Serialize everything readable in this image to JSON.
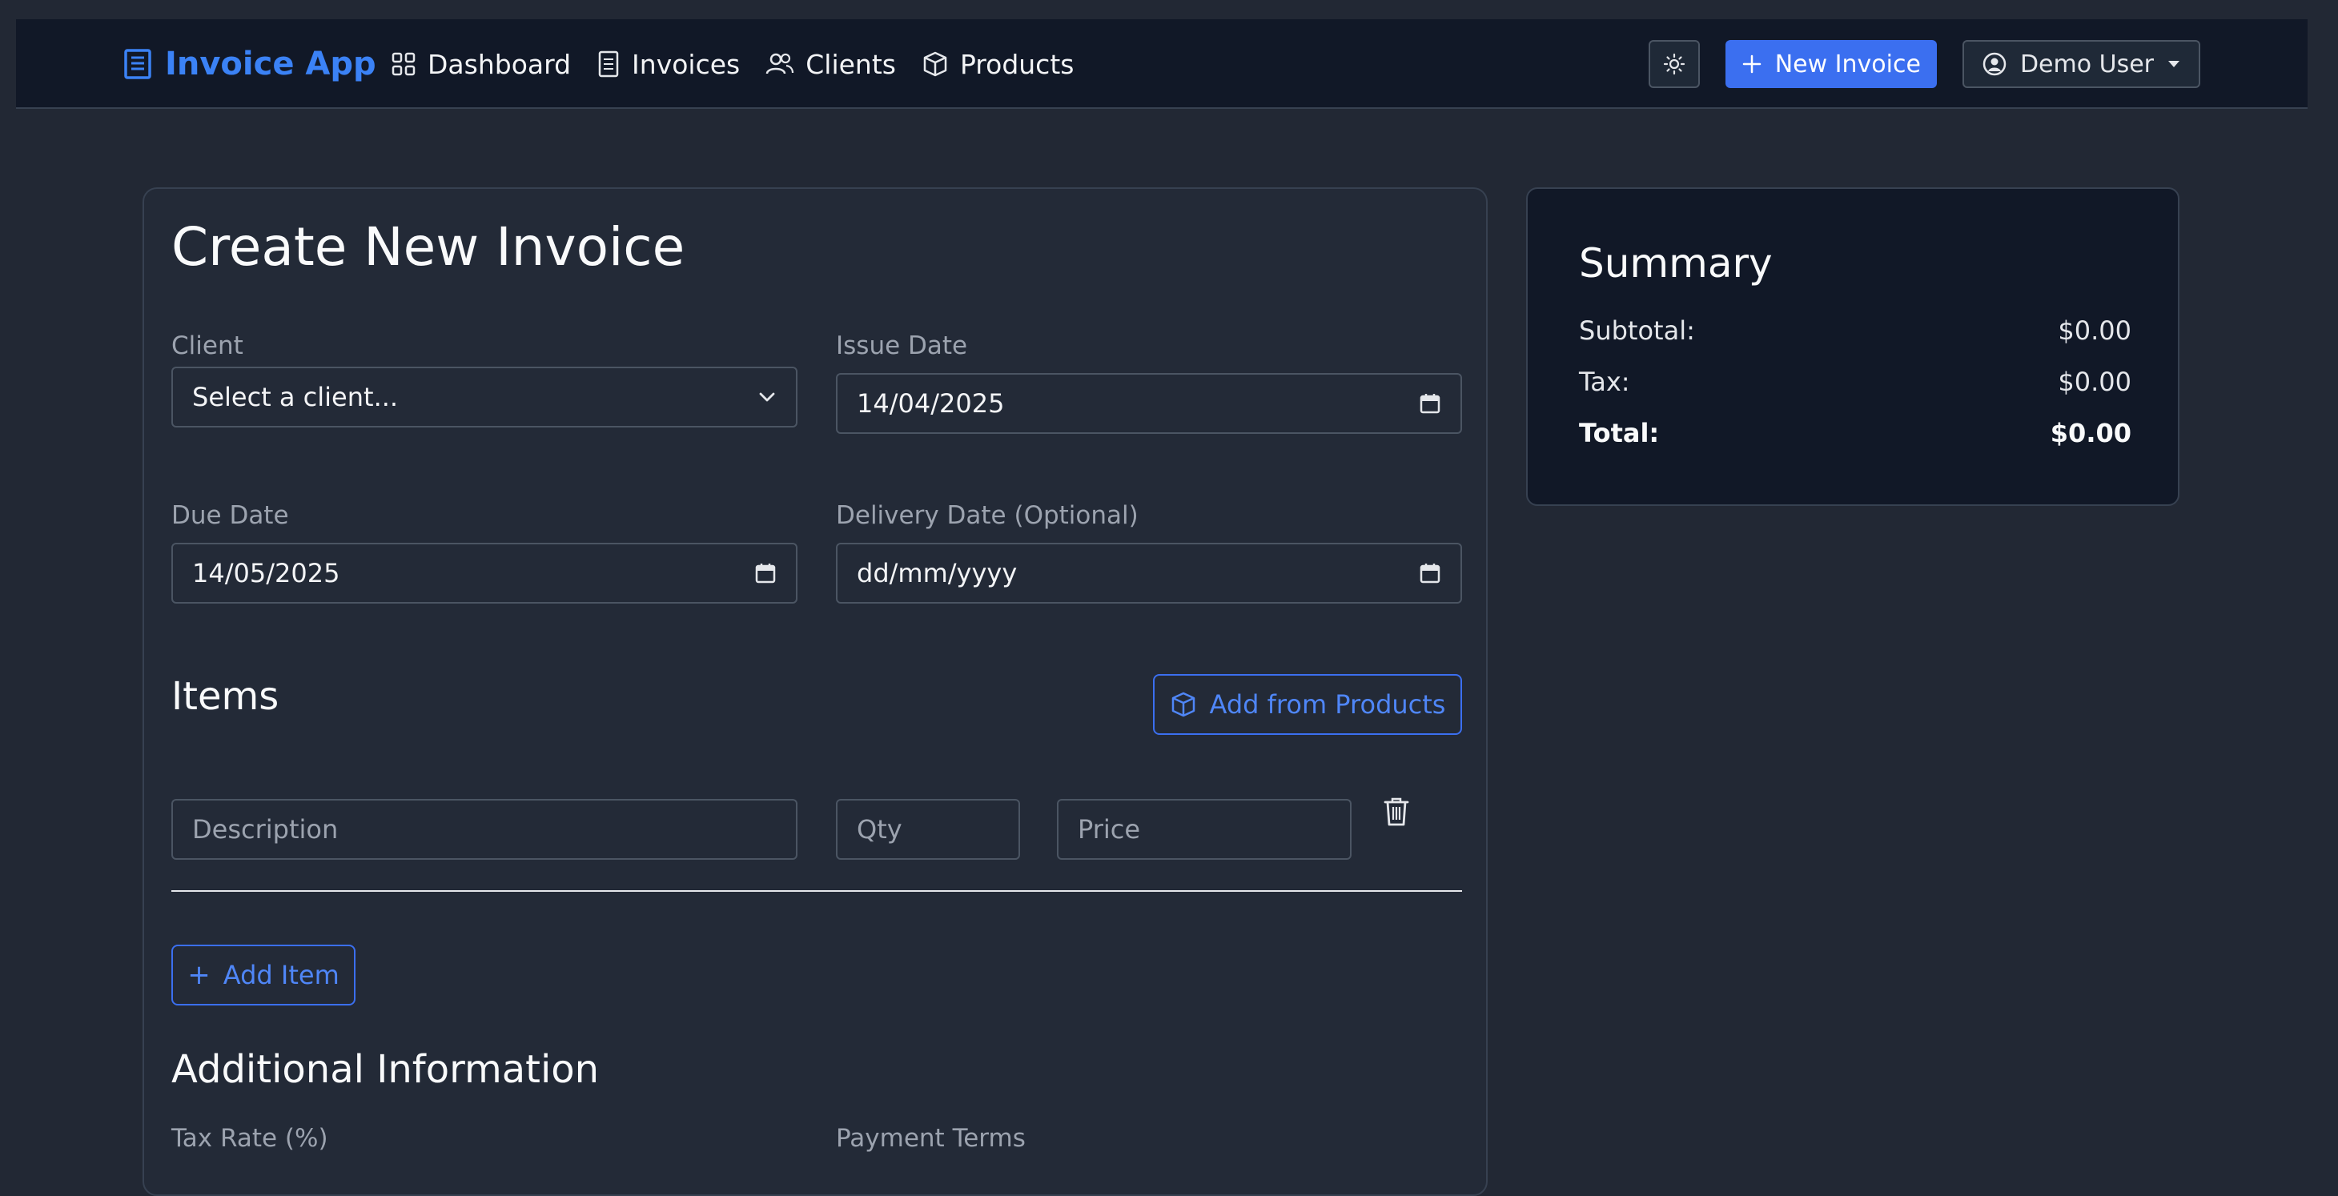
{
  "nav": {
    "brand": "Invoice App",
    "links": [
      {
        "label": "Dashboard",
        "icon": "dashboard-grid-icon"
      },
      {
        "label": "Invoices",
        "icon": "document-icon"
      },
      {
        "label": "Clients",
        "icon": "users-icon"
      },
      {
        "label": "Products",
        "icon": "box-icon"
      }
    ],
    "new_invoice_label": "New Invoice",
    "user_label": "Demo User"
  },
  "form": {
    "title": "Create New Invoice",
    "client_label": "Client",
    "client_value": "Select a client...",
    "issue_date_label": "Issue Date",
    "issue_date_value": "14/04/2025",
    "due_date_label": "Due Date",
    "due_date_value": "14/05/2025",
    "delivery_date_label": "Delivery Date (Optional)",
    "delivery_date_value": "dd/mm/yyyy",
    "items_title": "Items",
    "add_from_products_label": "Add from Products",
    "item_description_placeholder": "Description",
    "item_qty_placeholder": "Qty",
    "item_price_placeholder": "Price",
    "add_item_label": "Add Item",
    "additional_title": "Additional Information",
    "tax_rate_label": "Tax Rate (%)",
    "payment_terms_label": "Payment Terms"
  },
  "summary": {
    "title": "Summary",
    "subtotal_label": "Subtotal:",
    "subtotal_value": "$0.00",
    "tax_label": "Tax:",
    "tax_value": "$0.00",
    "total_label": "Total:",
    "total_value": "$0.00"
  },
  "colors": {
    "accent": "#3b6ff0",
    "background": "#222834",
    "navbar": "#111827"
  }
}
